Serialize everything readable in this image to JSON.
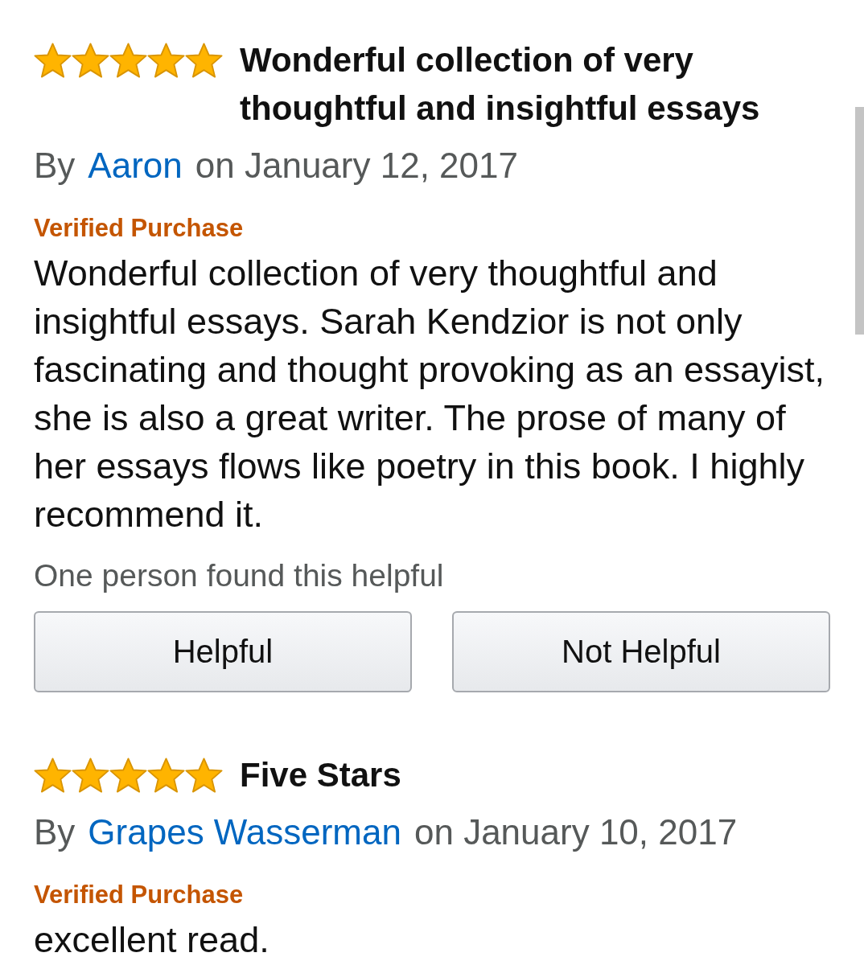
{
  "reviews": [
    {
      "stars": 5,
      "title": "Wonderful collection of very thoughtful and insightful essays",
      "by_label": "By",
      "author": "Aaron",
      "date": "on January 12, 2017",
      "badge": "Verified Purchase",
      "body": "Wonderful collection of very thoughtful and insightful essays. Sarah Kendzior is not only fascinating and thought provoking as an essayist, she is also a great writer. The prose of many of her essays flows like poetry in this book. I highly recommend it.",
      "helpful_count": "One person found this helpful",
      "buttons": [
        "Helpful",
        "Not Helpful"
      ]
    },
    {
      "stars": 5,
      "title": "Five Stars",
      "by_label": "By",
      "author": "Grapes Wasserman",
      "date": "on January 10, 2017",
      "badge": "Verified Purchase",
      "body": "excellent read."
    }
  ]
}
